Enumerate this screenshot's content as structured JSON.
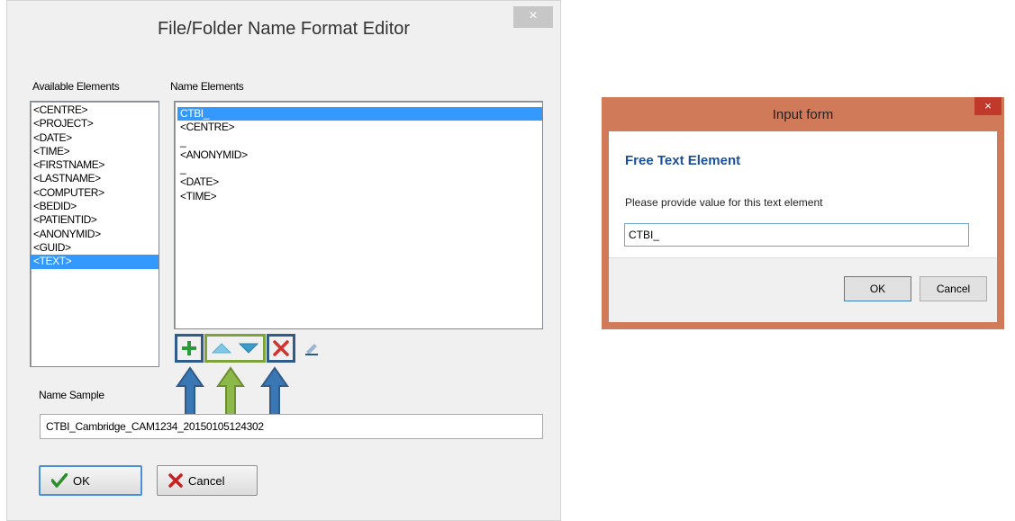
{
  "editor": {
    "title": "File/Folder Name Format Editor",
    "close_glyph": "×",
    "available_label": "Available Elements",
    "name_elements_label": "Name Elements",
    "available_elements": [
      "<CENTRE>",
      "<PROJECT>",
      "<DATE>",
      "<TIME>",
      "<FIRSTNAME>",
      "<LASTNAME>",
      "<COMPUTER>",
      "<BEDID>",
      "<PATIENTID>",
      "<ANONYMID>",
      "<GUID>",
      "<TEXT>"
    ],
    "available_selected_index": 11,
    "name_elements": [
      "CTBI_",
      "<CENTRE>",
      "_",
      "<ANONYMID>",
      "_",
      "<DATE>",
      "<TIME>"
    ],
    "name_elements_selected_index": 0,
    "name_sample_label": "Name Sample",
    "name_sample_value": "CTBI_Cambridge_CAM1234_20150105124302",
    "ok_label": "OK",
    "cancel_label": "Cancel",
    "colors": {
      "highlight_blue": "#2e5b8a",
      "highlight_green": "#7ea33a",
      "selection": "#3399ff"
    }
  },
  "input_form": {
    "title": "Input form",
    "close_glyph": "×",
    "heading": "Free Text Element",
    "prompt": "Please provide value for this text element",
    "value": "CTBI_",
    "ok_label": "OK",
    "cancel_label": "Cancel",
    "colors": {
      "frame": "#d07a5a",
      "heading": "#1a4f9c"
    }
  }
}
